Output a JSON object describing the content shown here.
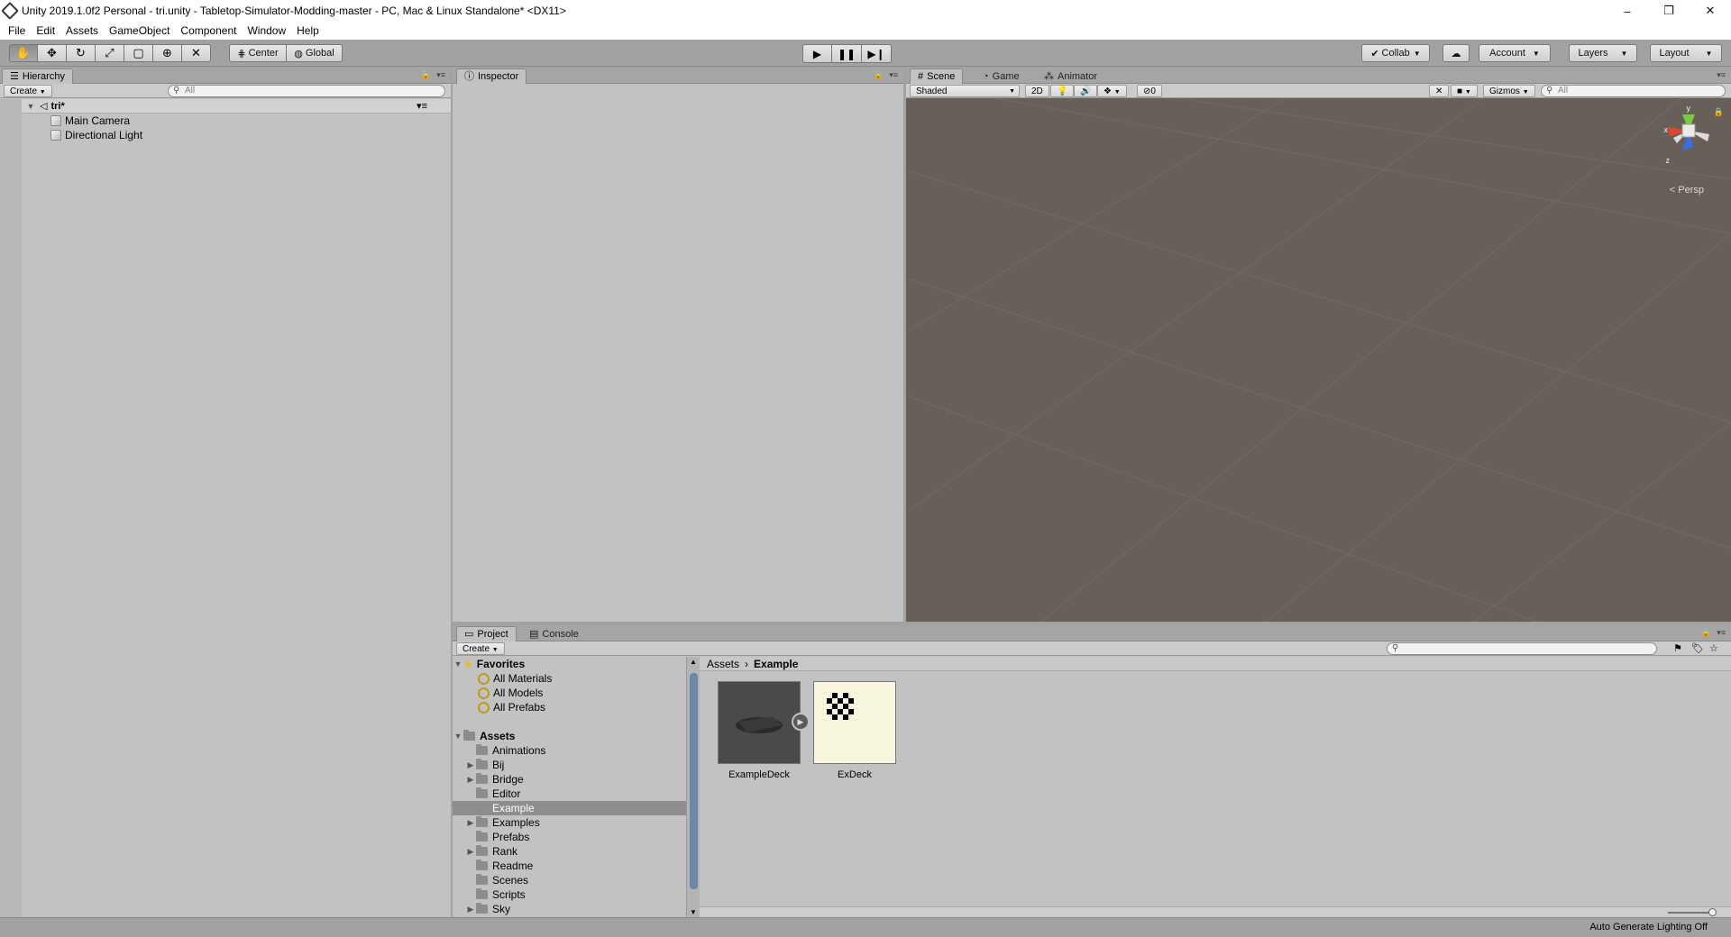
{
  "window": {
    "title": "Unity 2019.1.0f2 Personal - tri.unity - Tabletop-Simulator-Modding-master - PC, Mac & Linux Standalone* <DX11>",
    "minimize": "–",
    "restore": "❐",
    "close": "✕"
  },
  "menu": [
    "File",
    "Edit",
    "Assets",
    "GameObject",
    "Component",
    "Window",
    "Help"
  ],
  "toolbar": {
    "tools": [
      "hand-icon",
      "move-icon",
      "rotate-icon",
      "scale-icon",
      "rect-icon",
      "transform-icon",
      "custom-tool-icon"
    ],
    "pivot_label": "Center",
    "space_label": "Global",
    "collab_label": "Collab",
    "account_label": "Account",
    "layers_label": "Layers",
    "layout_label": "Layout"
  },
  "hierarchy": {
    "tab": "Hierarchy",
    "create": "Create",
    "search_placeholder": "All",
    "scene": "tri*",
    "items": [
      "Main Camera",
      "Directional Light"
    ]
  },
  "inspector": {
    "tab": "Inspector"
  },
  "scene_view": {
    "tabs": [
      "Scene",
      "Game",
      "Animator"
    ],
    "shading": "Shaded",
    "mode_2d": "2D",
    "hidden_count": "0",
    "gizmos": "Gizmos",
    "search_placeholder": "All",
    "gizmo_y": "y",
    "gizmo_x": "x",
    "gizmo_z": "z",
    "projection": "Persp",
    "background": "#686058"
  },
  "project": {
    "tabs": [
      "Project",
      "Console"
    ],
    "create": "Create",
    "favorites_label": "Favorites",
    "favorites": [
      "All Materials",
      "All Models",
      "All Prefabs"
    ],
    "assets_label": "Assets",
    "folders": [
      {
        "name": "Animations",
        "expandable": false
      },
      {
        "name": "Bij",
        "expandable": true
      },
      {
        "name": "Bridge",
        "expandable": true
      },
      {
        "name": "Editor",
        "expandable": false
      },
      {
        "name": "Example",
        "expandable": false,
        "selected": true
      },
      {
        "name": "Examples",
        "expandable": true
      },
      {
        "name": "Prefabs",
        "expandable": false
      },
      {
        "name": "Rank",
        "expandable": true
      },
      {
        "name": "Readme",
        "expandable": false
      },
      {
        "name": "Scenes",
        "expandable": false
      },
      {
        "name": "Scripts",
        "expandable": false
      },
      {
        "name": "Sky",
        "expandable": true
      }
    ],
    "breadcrumb": [
      "Assets",
      "Example"
    ],
    "assets": [
      {
        "name": "ExampleDeck",
        "type": "prefab"
      },
      {
        "name": "ExDeck",
        "type": "texture"
      }
    ]
  },
  "status": {
    "text": "Auto Generate Lighting Off"
  }
}
